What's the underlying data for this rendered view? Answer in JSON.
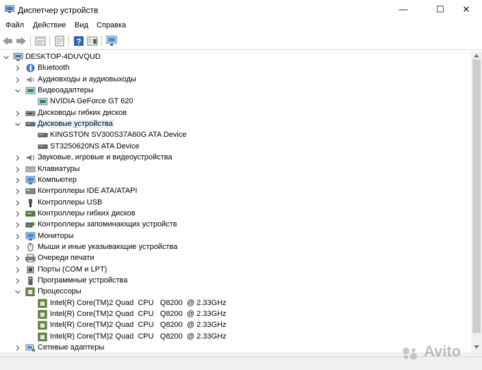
{
  "window": {
    "title": "Диспетчер устройств",
    "min_glyph": "—",
    "max_glyph": "☐",
    "close_glyph": "✕"
  },
  "menu": [
    "Файл",
    "Действие",
    "Вид",
    "Справка"
  ],
  "toolbar": {
    "icons": [
      "back-icon",
      "forward-icon",
      "properties-icon",
      "update-driver-icon",
      "help-icon",
      "view-icon",
      "scan-hardware-icon"
    ]
  },
  "tree": [
    {
      "label": "DESKTOP-4DUVQUD",
      "level": 0,
      "expanded": true,
      "icon": "computer-icon"
    },
    {
      "label": "Bluetooth",
      "level": 1,
      "expanded": false,
      "icon": "bluetooth-icon"
    },
    {
      "label": "Аудиовходы и аудиовыходы",
      "level": 1,
      "expanded": false,
      "icon": "audio-icon"
    },
    {
      "label": "Видеоадаптеры",
      "level": 1,
      "expanded": true,
      "icon": "display-adapter-icon"
    },
    {
      "label": "NVIDIA GeForce GT 620",
      "level": 2,
      "icon": "display-adapter-icon"
    },
    {
      "label": "Дисководы гибких дисков",
      "level": 1,
      "expanded": false,
      "icon": "floppy-drive-icon"
    },
    {
      "label": "Дисковые устройства",
      "level": 1,
      "expanded": true,
      "icon": "disk-drive-icon",
      "selected": true
    },
    {
      "label": "KINGSTON SV300S37A60G ATA Device",
      "level": 2,
      "icon": "disk-drive-icon"
    },
    {
      "label": "ST3250620NS ATA Device",
      "level": 2,
      "icon": "disk-drive-icon"
    },
    {
      "label": "Звуковые, игровые и видеоустройства",
      "level": 1,
      "expanded": false,
      "icon": "sound-icon"
    },
    {
      "label": "Клавиатуры",
      "level": 1,
      "expanded": false,
      "icon": "keyboard-icon"
    },
    {
      "label": "Компьютер",
      "level": 1,
      "expanded": false,
      "icon": "monitor-icon"
    },
    {
      "label": "Контроллеры IDE ATA/ATAPI",
      "level": 1,
      "expanded": false,
      "icon": "ide-controller-icon"
    },
    {
      "label": "Контроллеры USB",
      "level": 1,
      "expanded": false,
      "icon": "usb-icon"
    },
    {
      "label": "Контроллеры гибких дисков",
      "level": 1,
      "expanded": false,
      "icon": "floppy-controller-icon"
    },
    {
      "label": "Контроллеры запоминающих устройств",
      "level": 1,
      "expanded": false,
      "icon": "storage-controller-icon"
    },
    {
      "label": "Мониторы",
      "level": 1,
      "expanded": false,
      "icon": "monitor-icon"
    },
    {
      "label": "Мыши и иные указывающие устройства",
      "level": 1,
      "expanded": false,
      "icon": "mouse-icon"
    },
    {
      "label": "Очереди печати",
      "level": 1,
      "expanded": false,
      "icon": "printer-icon"
    },
    {
      "label": "Порты (COM и LPT)",
      "level": 1,
      "expanded": false,
      "icon": "port-icon"
    },
    {
      "label": "Программные устройства",
      "level": 1,
      "expanded": false,
      "icon": "software-device-icon"
    },
    {
      "label": "Процессоры",
      "level": 1,
      "expanded": true,
      "icon": "processor-icon"
    },
    {
      "label": "Intel(R) Core(TM)2 Quad  CPU   Q8200  @ 2.33GHz",
      "level": 2,
      "icon": "processor-icon"
    },
    {
      "label": "Intel(R) Core(TM)2 Quad  CPU   Q8200  @ 2.33GHz",
      "level": 2,
      "icon": "processor-icon"
    },
    {
      "label": "Intel(R) Core(TM)2 Quad  CPU   Q8200  @ 2.33GHz",
      "level": 2,
      "icon": "processor-icon"
    },
    {
      "label": "Intel(R) Core(TM)2 Quad  CPU   Q8200  @ 2.33GHz",
      "level": 2,
      "icon": "processor-icon"
    },
    {
      "label": "Сетевые адаптеры",
      "level": 1,
      "expanded": false,
      "icon": "network-adapter-icon"
    }
  ],
  "watermark": "Avito",
  "colors": {
    "selection": "#e5f3ff",
    "accent": "#0078d7"
  }
}
